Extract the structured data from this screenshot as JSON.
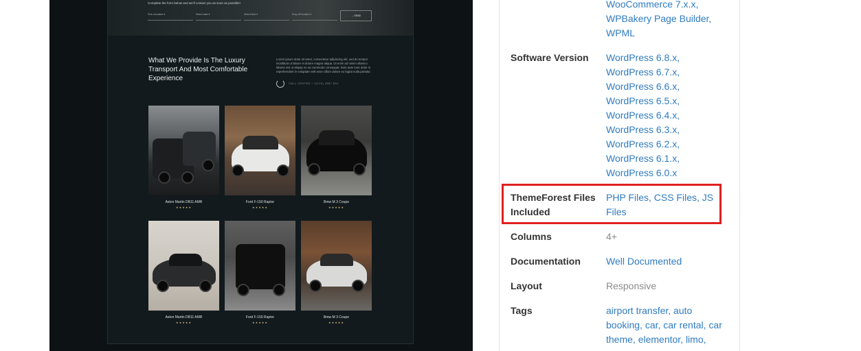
{
  "preview": {
    "hero_text": "Complete the form below and we'll contact you as soon as possible!",
    "form_fields": [
      "Pick a location ▾",
      "Select date ▾",
      "Select time ▾",
      "Drop off location ▾"
    ],
    "send_label": "→ SEND",
    "heading": "What We Provide Is The Luxury Transport And Most Comfortable Experience",
    "paragraph": "Lorem ipsum dolor sit amet, consectetur adipiscing elit, sed do tempor incididunt ut labore et dolore magna aliqua. Ut enim ad minim ullamco laboris nisi ut aliquip ex ea commodo consequat. Duis aute irure dolor in reprehenderit in voluptate velit esse cillum dolore eu fugiat nulla pariatur.",
    "call_text": "CALL CENTER + 1(123) 4567 891",
    "cars": [
      {
        "name": "Aston Martin DB11 AMR",
        "stars": "★★★★★"
      },
      {
        "name": "Ford F-150 Raptor",
        "stars": "★★★★★"
      },
      {
        "name": "Bmw M 3 Coupe",
        "stars": "★★★★★"
      },
      {
        "name": "Aston Martin DB11 AMR",
        "stars": "★★★★★"
      },
      {
        "name": "Ford F-150 Raptor",
        "stars": "★★★★★"
      },
      {
        "name": "Bmw M 3 Coupe",
        "stars": "★★★★★"
      }
    ]
  },
  "details": {
    "compatible_tail": [
      "WooCommerce 7.x.x,",
      "WPBakery Page Builder,",
      "WPML"
    ],
    "software_version": {
      "label": "Software Version",
      "values": [
        "WordPress 6.8.x,",
        "WordPress 6.7.x,",
        "WordPress 6.6.x,",
        "WordPress 6.5.x,",
        "WordPress 6.4.x,",
        "WordPress 6.3.x,",
        "WordPress 6.2.x,",
        "WordPress 6.1.x,",
        "WordPress 6.0.x"
      ]
    },
    "files_included": {
      "label_line1": "ThemeForest Files",
      "label_line2": "Included",
      "value_line1": "PHP Files, CSS Files, JS",
      "value_line2": "Files"
    },
    "columns": {
      "label": "Columns",
      "value": "4+"
    },
    "documentation": {
      "label": "Documentation",
      "value": "Well Documented"
    },
    "layout": {
      "label": "Layout",
      "value": "Responsive"
    },
    "tags": {
      "label": "Tags",
      "lines": [
        "airport transfer, auto",
        "booking, car, car rental, car",
        "theme, elementor, limo,"
      ]
    }
  },
  "colors": {
    "link": "#2f7bbf",
    "highlight": "#e02020",
    "preview_bg": "#121a1d"
  }
}
